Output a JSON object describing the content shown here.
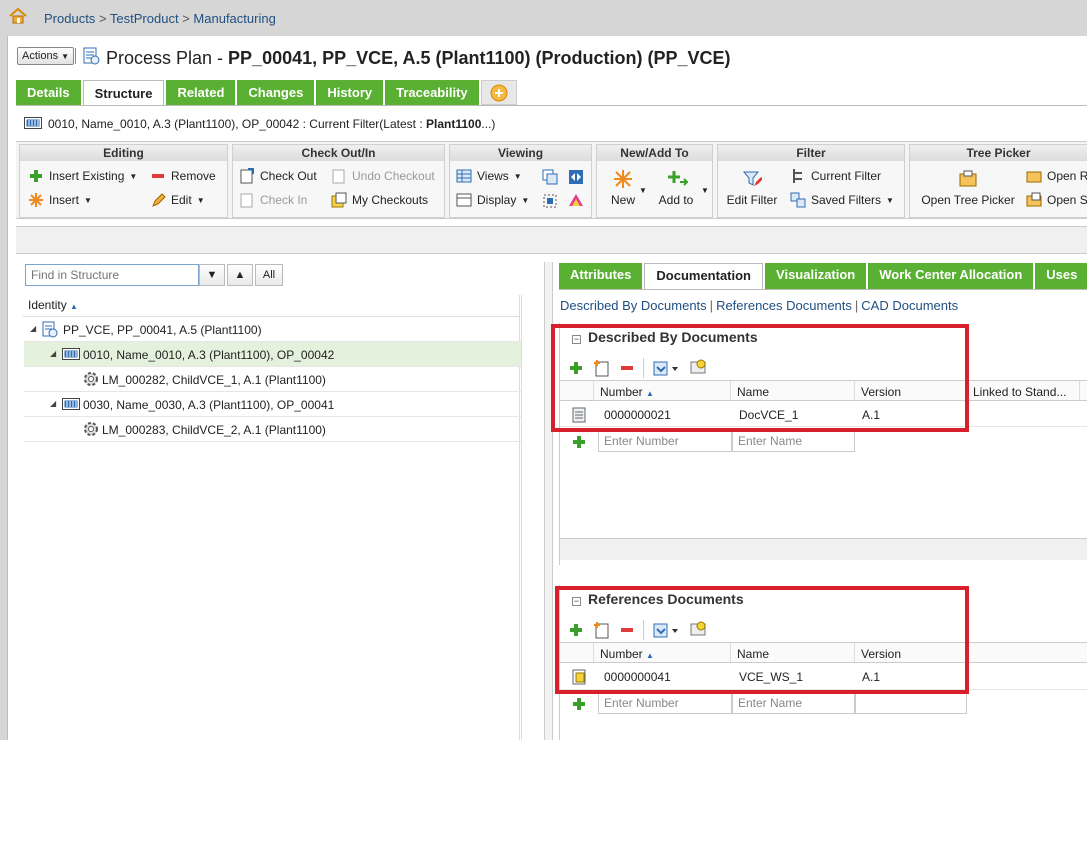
{
  "breadcrumb": {
    "items": [
      "Products",
      "TestProduct",
      "Manufacturing"
    ],
    "separator": ">"
  },
  "header": {
    "actions_label": "Actions",
    "title_prefix": "Process Plan - ",
    "title_bold": "PP_00041, PP_VCE, A.5 (Plant1100) (Production) (PP_VCE)"
  },
  "main_tabs": [
    "Details",
    "Structure",
    "Related",
    "Changes",
    "History",
    "Traceability"
  ],
  "context": {
    "text": "0010, Name_0010, A.3 (Plant1100), OP_00042  : Current Filter(Latest : ",
    "bold": "Plant1100",
    "suffix": "...)"
  },
  "ribbon": {
    "editing": {
      "title": "Editing",
      "insert_existing": "Insert Existing",
      "remove": "Remove",
      "insert": "Insert",
      "edit": "Edit"
    },
    "checkout": {
      "title": "Check Out/In",
      "check_out": "Check Out",
      "undo_checkout": "Undo Checkout",
      "check_in": "Check In",
      "my_checkouts": "My Checkouts"
    },
    "viewing": {
      "title": "Viewing",
      "views": "Views",
      "display": "Display"
    },
    "new_add": {
      "title": "New/Add To",
      "new": "New",
      "add_to": "Add to"
    },
    "filter": {
      "title": "Filter",
      "edit_filter": "Edit Filter",
      "current_filter": "Current Filter",
      "saved_filters": "Saved Filters"
    },
    "tree_picker": {
      "title": "Tree Picker",
      "open_tree_picker": "Open Tree Picker",
      "open_r": "Open R",
      "open_s": "Open S"
    }
  },
  "structure": {
    "find_placeholder": "Find in Structure",
    "all_label": "All",
    "column": "Identity",
    "rows": [
      {
        "label": "PP_VCE, PP_00041, A.5 (Plant1100)",
        "level": 0,
        "icon": "process-plan-icon"
      },
      {
        "label": "0010, Name_0010, A.3 (Plant1100), OP_00042",
        "level": 1,
        "icon": "operation-icon"
      },
      {
        "label": "LM_000282, ChildVCE_1, A.1 (Plant1100)",
        "level": 2,
        "icon": "gear-icon"
      },
      {
        "label": "0030, Name_0030, A.3 (Plant1100), OP_00041",
        "level": 1,
        "icon": "operation-icon"
      },
      {
        "label": "LM_000283, ChildVCE_2, A.1 (Plant1100)",
        "level": 2,
        "icon": "gear-icon"
      }
    ]
  },
  "detail_tabs": [
    "Attributes",
    "Documentation",
    "Visualization",
    "Work Center Allocation",
    "Uses"
  ],
  "doc_links": [
    "Described By Documents",
    "References Documents",
    "CAD Documents"
  ],
  "described": {
    "title": "Described By Documents",
    "columns": [
      "Number",
      "Name",
      "Version",
      "Linked to Stand..."
    ],
    "rows": [
      {
        "number": "0000000021",
        "name": "DocVCE_1",
        "version": "A.1"
      }
    ],
    "number_placeholder": "Enter Number",
    "name_placeholder": "Enter Name"
  },
  "references": {
    "title": "References Documents",
    "columns": [
      "Number",
      "Name",
      "Version"
    ],
    "rows": [
      {
        "number": "0000000041",
        "name": "VCE_WS_1",
        "version": "A.1"
      }
    ],
    "number_placeholder": "Enter Number",
    "name_placeholder": "Enter Name"
  },
  "colors": {
    "tab_green": "#5ab033",
    "highlight_red": "#d6202c",
    "link_blue": "#1f4f82"
  }
}
